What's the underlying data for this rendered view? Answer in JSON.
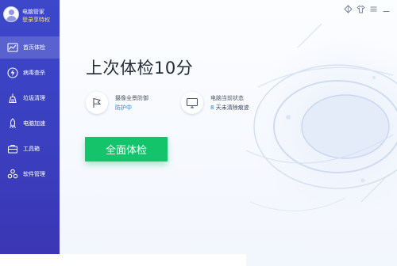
{
  "profile": {
    "name": "电脑管家",
    "login_link": "登录享特权"
  },
  "sidebar": {
    "items": [
      {
        "label": "首页体检",
        "icon": "chart-icon",
        "active": true
      },
      {
        "label": "病毒查杀",
        "icon": "lightning-icon",
        "active": false
      },
      {
        "label": "垃圾清理",
        "icon": "broom-icon",
        "active": false
      },
      {
        "label": "电脑加速",
        "icon": "rocket-icon",
        "active": false
      },
      {
        "label": "工具箱",
        "icon": "toolbox-icon",
        "active": false
      },
      {
        "label": "软件管理",
        "icon": "gear-cluster-icon",
        "active": false
      }
    ]
  },
  "titlebar": {
    "icons": [
      "diamond-icon",
      "shirt-icon",
      "menu-icon",
      "minimize-icon"
    ]
  },
  "main": {
    "headline": "上次体检10分",
    "status": [
      {
        "label": "摄像全景防御",
        "value": "防护中",
        "icon": "shield-flag-icon"
      },
      {
        "label": "电脑当前状态",
        "value_number": "8",
        "value_rest": "天未清除痕迹",
        "icon": "monitor-icon"
      }
    ],
    "scan_button": "全面体检"
  },
  "colors": {
    "sidebar": "#3c47ca",
    "accent_green": "#13c46b",
    "link_blue": "#2f7de1",
    "login_yellow": "#ffe36a"
  }
}
